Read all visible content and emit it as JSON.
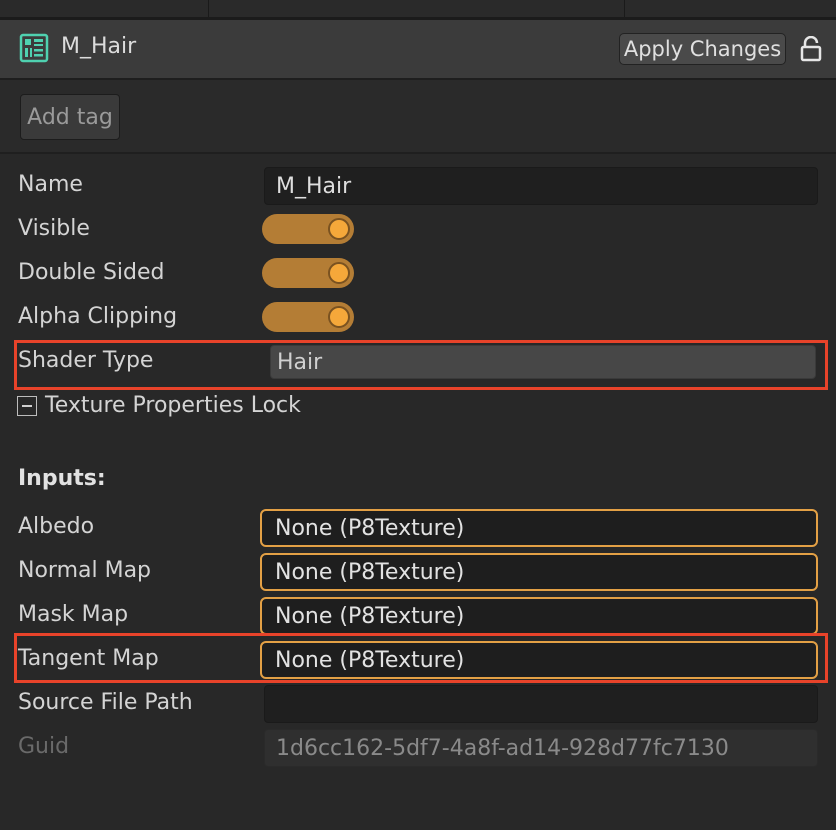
{
  "header": {
    "title": "M_Hair",
    "apply_label": "Apply Changes",
    "icons": {
      "material": "material-grid-icon",
      "lock": "lock-icon"
    }
  },
  "tags": {
    "add_label": "Add tag"
  },
  "properties": {
    "name": {
      "label": "Name",
      "value": "M_Hair"
    },
    "visible": {
      "label": "Visible",
      "on": true
    },
    "double_sided": {
      "label": "Double Sided",
      "on": true
    },
    "alpha_clipping": {
      "label": "Alpha Clipping",
      "on": true
    },
    "shader_type": {
      "label": "Shader Type",
      "value": "Hair"
    },
    "texture_lock": {
      "label": "Texture Properties Lock"
    }
  },
  "inputs": {
    "heading": "Inputs:",
    "albedo": {
      "label": "Albedo",
      "value": "None (P8Texture)"
    },
    "normal_map": {
      "label": "Normal Map",
      "value": "None (P8Texture)"
    },
    "mask_map": {
      "label": "Mask Map",
      "value": "None (P8Texture)"
    },
    "tangent_map": {
      "label": "Tangent Map",
      "value": "None (P8Texture)"
    }
  },
  "meta": {
    "source_file_path": {
      "label": "Source File Path",
      "value": ""
    },
    "guid": {
      "label": "Guid",
      "value": "1d6cc162-5df7-4a8f-ad14-928d77fc7130"
    }
  },
  "colors": {
    "accent": "#f5a83a",
    "toggle_track": "#b47d35",
    "texture_border": "#e3a045",
    "highlight": "#e8432a",
    "icon_teal": "#4fd1b0"
  }
}
